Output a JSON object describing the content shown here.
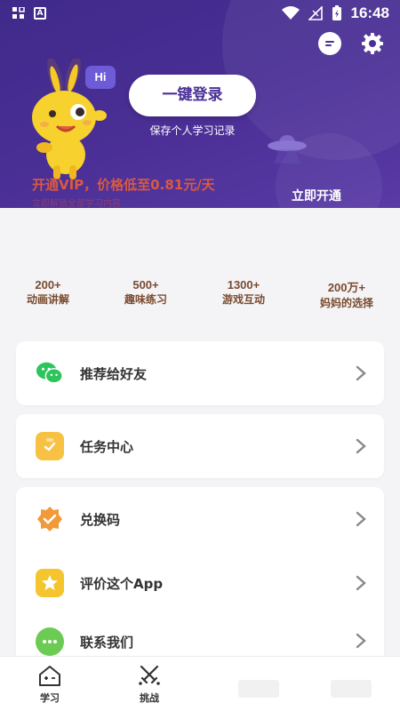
{
  "status_bar": {
    "time": "16:48"
  },
  "header": {
    "hi_bubble": "Hi",
    "login_button": "一键登录",
    "login_subtitle": "保存个人学习记录",
    "vip_title": "开通VIP，价格低至0.81元/天",
    "vip_subtitle": "立即解锁全部学习内容",
    "vip_button": "立即开通"
  },
  "stats": [
    {
      "num": "200+",
      "label": "动画讲解"
    },
    {
      "num": "500+",
      "label": "趣味练习"
    },
    {
      "num": "1300+",
      "label": "游戏互动"
    },
    {
      "num": "200万+",
      "label": "妈妈的选择"
    }
  ],
  "menu": {
    "share": "推荐给好友",
    "tasks": "任务中心",
    "redeem": "兑换码",
    "rate": "评价这个App",
    "contact": "联系我们"
  },
  "tabs": {
    "learn": "学习",
    "challenge": "挑战"
  },
  "colors": {
    "header_bg": "#4b2f96",
    "vip_text": "#d85a40",
    "wechat_green": "#2ec45c",
    "task_yellow": "#f7c244",
    "redeem_orange": "#f29a3a",
    "rate_yellow": "#f5c52e",
    "contact_green": "#6ccb52"
  }
}
